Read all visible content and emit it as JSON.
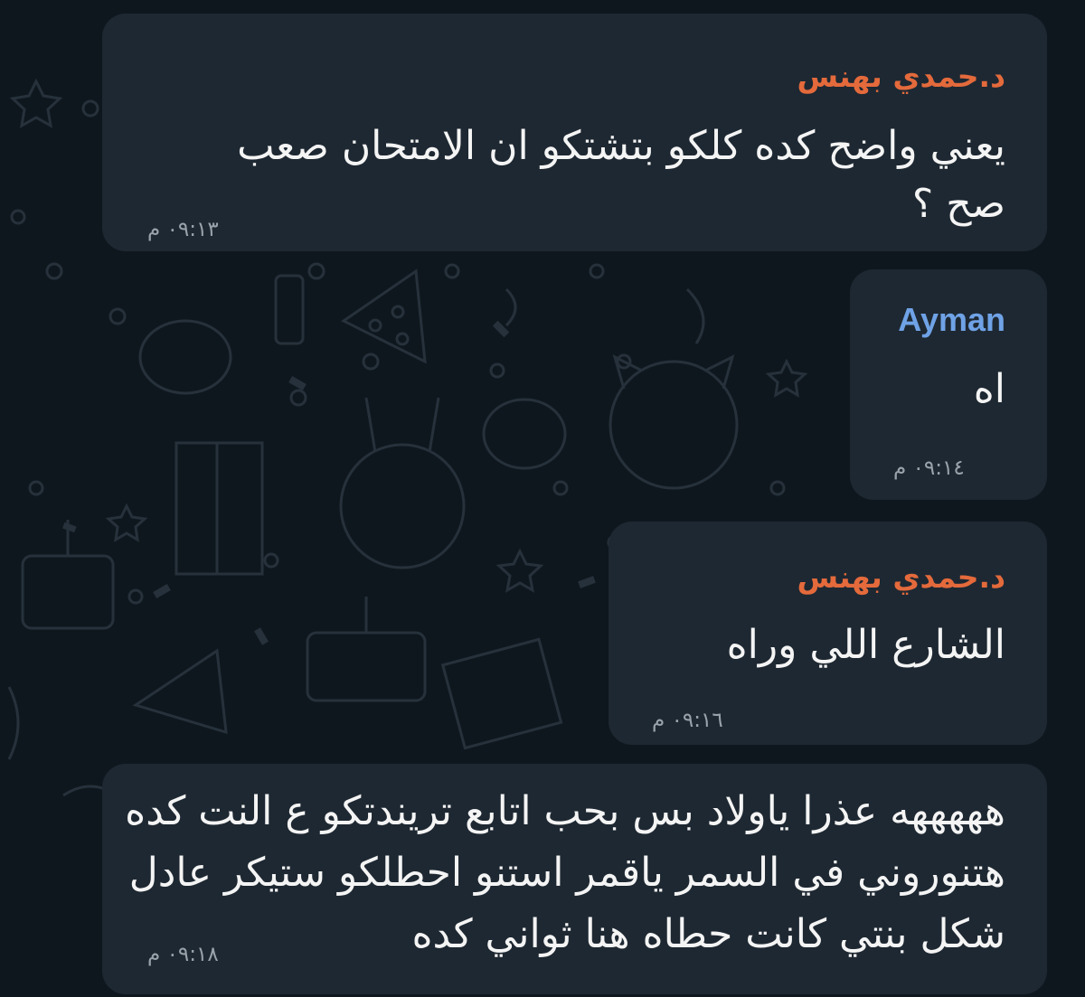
{
  "messages": [
    {
      "sender": "د.حمدي بهنس",
      "lines": [
        "يعني واضح كده كلكو بتشتكو ان الامتحان صعب",
        "صح ؟"
      ],
      "time": "٠٩:١٣ م"
    },
    {
      "sender": "Ayman",
      "lines": [
        "اه"
      ],
      "time": "٠٩:١٤ م"
    },
    {
      "sender": "د.حمدي بهنس",
      "lines": [
        "الشارع اللي وراه"
      ],
      "time": "٠٩:١٦ م"
    },
    {
      "sender": "",
      "lines": [
        "هههههه عذرا ياولاد بس بحب اتابع تريندتكو ع النت كده",
        "هتنوروني في السمر ياقمر استنو احطلكو ستيكر عادل",
        "شكل بنتي كانت حطاه هنا ثواني كده"
      ],
      "time": "٠٩:١٨ م"
    }
  ],
  "colors": {
    "background": "#0f171e",
    "bubble": "#1e2832",
    "sender_dr": "#e46a3c",
    "sender_ayman": "#6fa2e6",
    "time": "#9aa3ab"
  }
}
